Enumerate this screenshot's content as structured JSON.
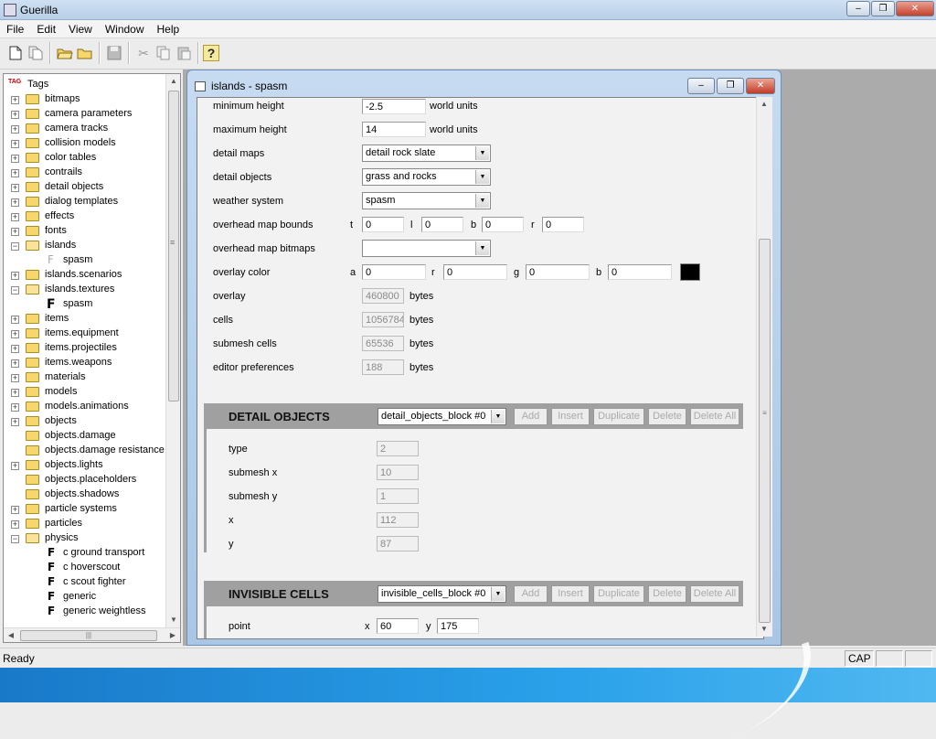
{
  "app": {
    "title": "Guerilla"
  },
  "window_controls": {
    "minimize": "–",
    "restore": "❐",
    "close": "✕"
  },
  "menu": [
    "File",
    "Edit",
    "View",
    "Window",
    "Help"
  ],
  "toolbar": {
    "icons": [
      "new-icon",
      "new-multi-icon",
      "open-icon",
      "open-folder-icon",
      "save-icon",
      "cut-icon",
      "copy-icon",
      "paste-icon",
      "help-icon"
    ],
    "help_glyph": "?"
  },
  "tree": {
    "root": "Tags",
    "root_icon_text": "TAG",
    "nodes": [
      {
        "label": "bitmaps",
        "type": "folder",
        "expand": "+"
      },
      {
        "label": "camera parameters",
        "type": "folder",
        "expand": "+"
      },
      {
        "label": "camera tracks",
        "type": "folder",
        "expand": "+"
      },
      {
        "label": "collision models",
        "type": "folder",
        "expand": "+"
      },
      {
        "label": "color tables",
        "type": "folder",
        "expand": "+"
      },
      {
        "label": "contrails",
        "type": "folder",
        "expand": "+"
      },
      {
        "label": "detail objects",
        "type": "folder",
        "expand": "+"
      },
      {
        "label": "dialog templates",
        "type": "folder",
        "expand": "+"
      },
      {
        "label": "effects",
        "type": "folder",
        "expand": "+"
      },
      {
        "label": "fonts",
        "type": "folder",
        "expand": "+"
      },
      {
        "label": "islands",
        "type": "open-folder",
        "expand": "−"
      },
      {
        "label": "spasm",
        "type": "file-gray"
      },
      {
        "label": "islands.scenarios",
        "type": "folder",
        "expand": "+"
      },
      {
        "label": "islands.textures",
        "type": "open-folder",
        "expand": "−"
      },
      {
        "label": "spasm",
        "type": "file-big"
      },
      {
        "label": "items",
        "type": "folder",
        "expand": "+"
      },
      {
        "label": "items.equipment",
        "type": "folder",
        "expand": "+"
      },
      {
        "label": "items.projectiles",
        "type": "folder",
        "expand": "+"
      },
      {
        "label": "items.weapons",
        "type": "folder",
        "expand": "+"
      },
      {
        "label": "materials",
        "type": "folder",
        "expand": "+"
      },
      {
        "label": "models",
        "type": "folder",
        "expand": "+"
      },
      {
        "label": "models.animations",
        "type": "folder",
        "expand": "+"
      },
      {
        "label": "objects",
        "type": "folder",
        "expand": "+"
      },
      {
        "label": "objects.damage",
        "type": "folder-leaf"
      },
      {
        "label": "objects.damage resistance",
        "type": "folder-leaf"
      },
      {
        "label": "objects.lights",
        "type": "folder",
        "expand": "+"
      },
      {
        "label": "objects.placeholders",
        "type": "folder-leaf"
      },
      {
        "label": "objects.shadows",
        "type": "folder-leaf"
      },
      {
        "label": "particle systems",
        "type": "folder",
        "expand": "+"
      },
      {
        "label": "particles",
        "type": "folder",
        "expand": "+"
      },
      {
        "label": "physics",
        "type": "open-folder",
        "expand": "−"
      },
      {
        "label": "c ground transport",
        "type": "file"
      },
      {
        "label": "c hoverscout",
        "type": "file"
      },
      {
        "label": "c scout fighter",
        "type": "file"
      },
      {
        "label": "generic",
        "type": "file"
      },
      {
        "label": "generic weightless",
        "type": "file"
      }
    ],
    "file_glyph": "F",
    "scroll_glyphs": {
      "up": "▲",
      "down": "▼",
      "left": "◀",
      "right": "▶",
      "grip_v": "≡",
      "grip_h": "|||"
    }
  },
  "child_window": {
    "title": "islands - spasm",
    "fields": [
      {
        "label": "minimum height",
        "value": "-2.5",
        "unit": "world units"
      },
      {
        "label": "maximum height",
        "value": "14",
        "unit": "world units"
      },
      {
        "label": "detail maps",
        "value": "detail rock slate"
      },
      {
        "label": "detail objects",
        "value": "grass and rocks"
      },
      {
        "label": "weather system",
        "value": "spasm"
      }
    ],
    "bounds": {
      "label": "overhead map bounds",
      "t": "0",
      "l": "0",
      "b": "0",
      "r": "0",
      "t_label": "t",
      "l_label": "l",
      "b_label": "b",
      "r_label": "r"
    },
    "bitmaps": {
      "label": "overhead map bitmaps",
      "value": ""
    },
    "overlay_color": {
      "label": "overlay color",
      "a_label": "a",
      "r_label": "r",
      "g_label": "g",
      "b_label": "b",
      "a": "0",
      "r": "0",
      "g": "0",
      "b": "0",
      "swatch": "#000000"
    },
    "stats": [
      {
        "label": "overlay",
        "value": "460800",
        "unit": "bytes"
      },
      {
        "label": "cells",
        "value": "1056784",
        "unit": "bytes"
      },
      {
        "label": "submesh cells",
        "value": "65536",
        "unit": "bytes"
      },
      {
        "label": "editor preferences",
        "value": "188",
        "unit": "bytes"
      }
    ],
    "block_buttons": [
      "Add",
      "Insert",
      "Duplicate",
      "Delete",
      "Delete All"
    ],
    "detail_objects": {
      "title": "DETAIL OBJECTS",
      "selector": "detail_objects_block #0",
      "fields": [
        {
          "label": "type",
          "value": "2"
        },
        {
          "label": "submesh x",
          "value": "10"
        },
        {
          "label": "submesh y",
          "value": "1"
        },
        {
          "label": "x",
          "value": "112"
        },
        {
          "label": "y",
          "value": "87"
        }
      ]
    },
    "invisible_cells": {
      "title": "INVISIBLE CELLS",
      "selector": "invisible_cells_block #0",
      "point_label": "point",
      "x_label": "x",
      "x": "60",
      "y_label": "y",
      "y": "175"
    },
    "dropdown_glyph": "▼"
  },
  "status": {
    "text": "Ready",
    "cap": "CAP"
  }
}
